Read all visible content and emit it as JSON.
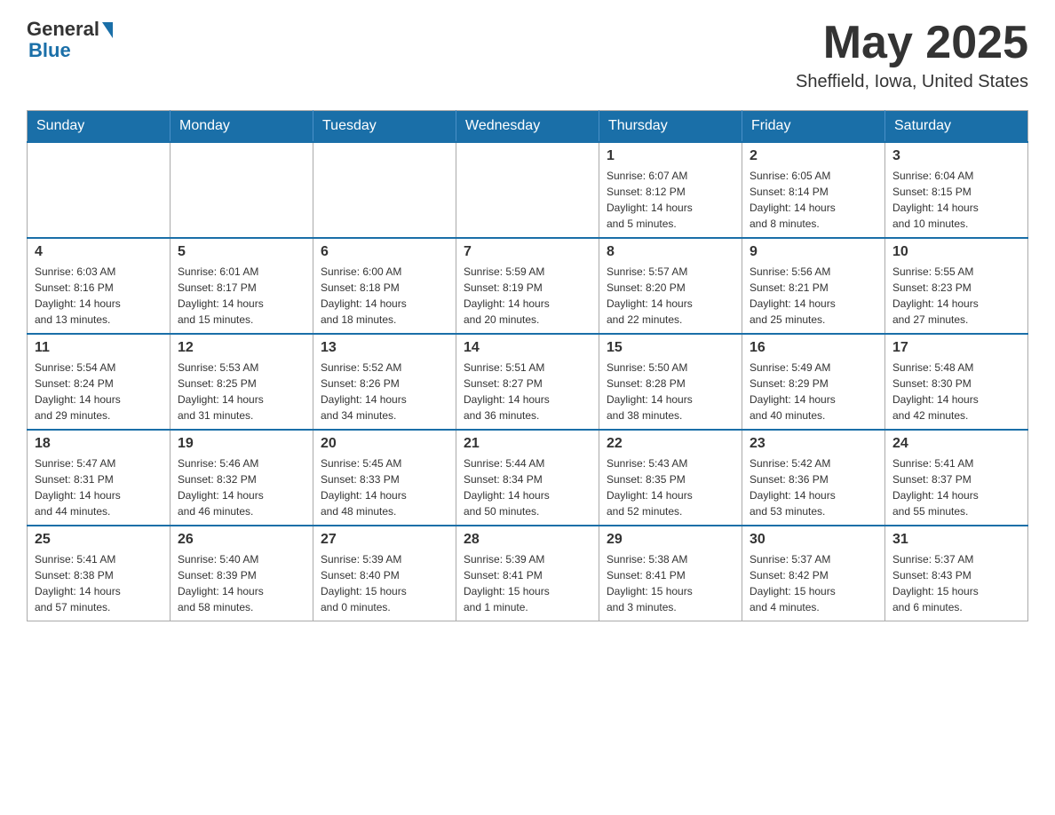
{
  "header": {
    "logo": {
      "general": "General",
      "blue": "Blue"
    },
    "title": "May 2025",
    "location": "Sheffield, Iowa, United States"
  },
  "weekdays": [
    "Sunday",
    "Monday",
    "Tuesday",
    "Wednesday",
    "Thursday",
    "Friday",
    "Saturday"
  ],
  "weeks": [
    [
      {
        "day": "",
        "info": ""
      },
      {
        "day": "",
        "info": ""
      },
      {
        "day": "",
        "info": ""
      },
      {
        "day": "",
        "info": ""
      },
      {
        "day": "1",
        "info": "Sunrise: 6:07 AM\nSunset: 8:12 PM\nDaylight: 14 hours\nand 5 minutes."
      },
      {
        "day": "2",
        "info": "Sunrise: 6:05 AM\nSunset: 8:14 PM\nDaylight: 14 hours\nand 8 minutes."
      },
      {
        "day": "3",
        "info": "Sunrise: 6:04 AM\nSunset: 8:15 PM\nDaylight: 14 hours\nand 10 minutes."
      }
    ],
    [
      {
        "day": "4",
        "info": "Sunrise: 6:03 AM\nSunset: 8:16 PM\nDaylight: 14 hours\nand 13 minutes."
      },
      {
        "day": "5",
        "info": "Sunrise: 6:01 AM\nSunset: 8:17 PM\nDaylight: 14 hours\nand 15 minutes."
      },
      {
        "day": "6",
        "info": "Sunrise: 6:00 AM\nSunset: 8:18 PM\nDaylight: 14 hours\nand 18 minutes."
      },
      {
        "day": "7",
        "info": "Sunrise: 5:59 AM\nSunset: 8:19 PM\nDaylight: 14 hours\nand 20 minutes."
      },
      {
        "day": "8",
        "info": "Sunrise: 5:57 AM\nSunset: 8:20 PM\nDaylight: 14 hours\nand 22 minutes."
      },
      {
        "day": "9",
        "info": "Sunrise: 5:56 AM\nSunset: 8:21 PM\nDaylight: 14 hours\nand 25 minutes."
      },
      {
        "day": "10",
        "info": "Sunrise: 5:55 AM\nSunset: 8:23 PM\nDaylight: 14 hours\nand 27 minutes."
      }
    ],
    [
      {
        "day": "11",
        "info": "Sunrise: 5:54 AM\nSunset: 8:24 PM\nDaylight: 14 hours\nand 29 minutes."
      },
      {
        "day": "12",
        "info": "Sunrise: 5:53 AM\nSunset: 8:25 PM\nDaylight: 14 hours\nand 31 minutes."
      },
      {
        "day": "13",
        "info": "Sunrise: 5:52 AM\nSunset: 8:26 PM\nDaylight: 14 hours\nand 34 minutes."
      },
      {
        "day": "14",
        "info": "Sunrise: 5:51 AM\nSunset: 8:27 PM\nDaylight: 14 hours\nand 36 minutes."
      },
      {
        "day": "15",
        "info": "Sunrise: 5:50 AM\nSunset: 8:28 PM\nDaylight: 14 hours\nand 38 minutes."
      },
      {
        "day": "16",
        "info": "Sunrise: 5:49 AM\nSunset: 8:29 PM\nDaylight: 14 hours\nand 40 minutes."
      },
      {
        "day": "17",
        "info": "Sunrise: 5:48 AM\nSunset: 8:30 PM\nDaylight: 14 hours\nand 42 minutes."
      }
    ],
    [
      {
        "day": "18",
        "info": "Sunrise: 5:47 AM\nSunset: 8:31 PM\nDaylight: 14 hours\nand 44 minutes."
      },
      {
        "day": "19",
        "info": "Sunrise: 5:46 AM\nSunset: 8:32 PM\nDaylight: 14 hours\nand 46 minutes."
      },
      {
        "day": "20",
        "info": "Sunrise: 5:45 AM\nSunset: 8:33 PM\nDaylight: 14 hours\nand 48 minutes."
      },
      {
        "day": "21",
        "info": "Sunrise: 5:44 AM\nSunset: 8:34 PM\nDaylight: 14 hours\nand 50 minutes."
      },
      {
        "day": "22",
        "info": "Sunrise: 5:43 AM\nSunset: 8:35 PM\nDaylight: 14 hours\nand 52 minutes."
      },
      {
        "day": "23",
        "info": "Sunrise: 5:42 AM\nSunset: 8:36 PM\nDaylight: 14 hours\nand 53 minutes."
      },
      {
        "day": "24",
        "info": "Sunrise: 5:41 AM\nSunset: 8:37 PM\nDaylight: 14 hours\nand 55 minutes."
      }
    ],
    [
      {
        "day": "25",
        "info": "Sunrise: 5:41 AM\nSunset: 8:38 PM\nDaylight: 14 hours\nand 57 minutes."
      },
      {
        "day": "26",
        "info": "Sunrise: 5:40 AM\nSunset: 8:39 PM\nDaylight: 14 hours\nand 58 minutes."
      },
      {
        "day": "27",
        "info": "Sunrise: 5:39 AM\nSunset: 8:40 PM\nDaylight: 15 hours\nand 0 minutes."
      },
      {
        "day": "28",
        "info": "Sunrise: 5:39 AM\nSunset: 8:41 PM\nDaylight: 15 hours\nand 1 minute."
      },
      {
        "day": "29",
        "info": "Sunrise: 5:38 AM\nSunset: 8:41 PM\nDaylight: 15 hours\nand 3 minutes."
      },
      {
        "day": "30",
        "info": "Sunrise: 5:37 AM\nSunset: 8:42 PM\nDaylight: 15 hours\nand 4 minutes."
      },
      {
        "day": "31",
        "info": "Sunrise: 5:37 AM\nSunset: 8:43 PM\nDaylight: 15 hours\nand 6 minutes."
      }
    ]
  ]
}
